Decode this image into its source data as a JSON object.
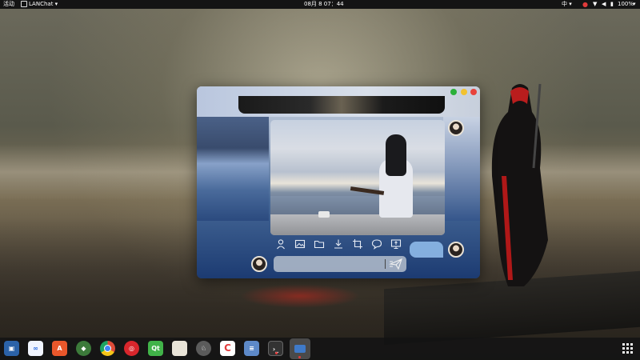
{
  "topbar": {
    "activities": "活动",
    "app_name": "LANChat",
    "clock": "08月 8  07：44",
    "input_method": "中",
    "battery": "100%"
  },
  "window": {
    "controls": [
      "minimize-green",
      "maximize-yellow",
      "close-red"
    ],
    "toolbar_icons": [
      "user-icon",
      "image-icon",
      "folder-icon",
      "download-icon",
      "screenshot-icon",
      "chat-bubble-icon",
      "screen-share-icon"
    ],
    "message_input": {
      "value": "",
      "placeholder": ""
    }
  },
  "taskbar": {
    "apps": [
      {
        "name": "virtualbox",
        "label": "",
        "color": "#2b62a8"
      },
      {
        "name": "baidu-netdisk",
        "label": "",
        "color": "#f0f4ff"
      },
      {
        "name": "software-center",
        "label": "A",
        "color": "#e9572b"
      },
      {
        "name": "android-studio",
        "label": "",
        "color": "#3c7a3a"
      },
      {
        "name": "chrome",
        "label": "",
        "color": "#dd4b39"
      },
      {
        "name": "netease-music",
        "label": "",
        "color": "#d8262c"
      },
      {
        "name": "qt-creator",
        "label": "Qt",
        "color": "#41b349"
      },
      {
        "name": "files",
        "label": "",
        "color": "#e9e4d8"
      },
      {
        "name": "sheep-app",
        "label": "",
        "color": "#5b5b5b"
      },
      {
        "name": "clion",
        "label": "C",
        "color": "#e23b3b"
      },
      {
        "name": "text-editor",
        "label": "",
        "color": "#5d89c8"
      },
      {
        "name": "terminal",
        "label": "",
        "color": "#333333"
      },
      {
        "name": "lanchat",
        "label": "",
        "color": "#3f5f9a"
      }
    ]
  }
}
